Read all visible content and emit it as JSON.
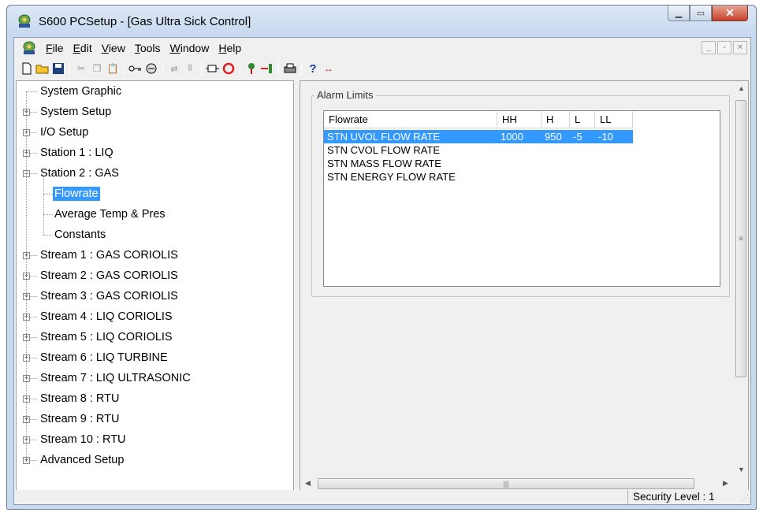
{
  "window": {
    "title": "S600 PCSetup  - [Gas Ultra Sick Control]",
    "caption_buttons": [
      "minimize-icon",
      "maximize-icon",
      "close-icon"
    ]
  },
  "menu": {
    "items": [
      "File",
      "Edit",
      "View",
      "Tools",
      "Window",
      "Help"
    ]
  },
  "toolbar": {
    "icons": [
      "new-icon",
      "open-icon",
      "save-icon",
      "cut-icon",
      "copy-icon",
      "paste-icon",
      "key-icon",
      "connect-icon",
      "transfer-icon",
      "columns-icon",
      "module-icon",
      "stop-icon",
      "upload-icon",
      "download-icon",
      "print-icon",
      "help-icon",
      "whats-this-icon"
    ]
  },
  "tree": {
    "items": [
      {
        "label": "System Graphic",
        "level": 0,
        "expander": ""
      },
      {
        "label": "System Setup",
        "level": 0,
        "expander": "+"
      },
      {
        "label": "I/O Setup",
        "level": 0,
        "expander": "+"
      },
      {
        "label": "Station 1 : LIQ",
        "level": 0,
        "expander": "+"
      },
      {
        "label": "Station 2 : GAS",
        "level": 0,
        "expander": "-"
      },
      {
        "label": "Flowrate",
        "level": 1,
        "expander": "",
        "selected": true
      },
      {
        "label": "Average Temp & Pres",
        "level": 1,
        "expander": ""
      },
      {
        "label": "Constants",
        "level": 1,
        "expander": ""
      },
      {
        "label": "Stream 1 : GAS CORIOLIS",
        "level": 0,
        "expander": "+"
      },
      {
        "label": "Stream 2 : GAS CORIOLIS",
        "level": 0,
        "expander": "+"
      },
      {
        "label": "Stream 3 : GAS CORIOLIS",
        "level": 0,
        "expander": "+"
      },
      {
        "label": "Stream 4 : LIQ CORIOLIS",
        "level": 0,
        "expander": "+"
      },
      {
        "label": "Stream 5 : LIQ CORIOLIS",
        "level": 0,
        "expander": "+"
      },
      {
        "label": "Stream 6 : LIQ TURBINE",
        "level": 0,
        "expander": "+"
      },
      {
        "label": "Stream 7 : LIQ ULTRASONIC",
        "level": 0,
        "expander": "+"
      },
      {
        "label": "Stream 8 : RTU",
        "level": 0,
        "expander": "+"
      },
      {
        "label": "Stream 9 : RTU",
        "level": 0,
        "expander": "+"
      },
      {
        "label": "Stream 10 : RTU",
        "level": 0,
        "expander": "+"
      },
      {
        "label": "Advanced Setup",
        "level": 0,
        "expander": "+"
      }
    ]
  },
  "alarm_limits": {
    "caption": "Alarm Limits",
    "columns": [
      "Flowrate",
      "HH",
      "H",
      "L",
      "LL"
    ],
    "rows": [
      {
        "name": "STN UVOL  FLOW RATE",
        "hh": "1000",
        "h": "950",
        "l": "-5",
        "ll": "-10",
        "selected": true
      },
      {
        "name": "STN CVOL  FLOW RATE",
        "hh": "",
        "h": "",
        "l": "",
        "ll": ""
      },
      {
        "name": "STN MASS  FLOW RATE",
        "hh": "",
        "h": "",
        "l": "",
        "ll": ""
      },
      {
        "name": "STN ENERGY FLOW RATE",
        "hh": "",
        "h": "",
        "l": "",
        "ll": ""
      }
    ]
  },
  "status": {
    "security": "Security Level : 1"
  },
  "colors": {
    "selection": "#3399ff",
    "window_frame": "#c9d9ee",
    "close_button": "#c7412b"
  }
}
